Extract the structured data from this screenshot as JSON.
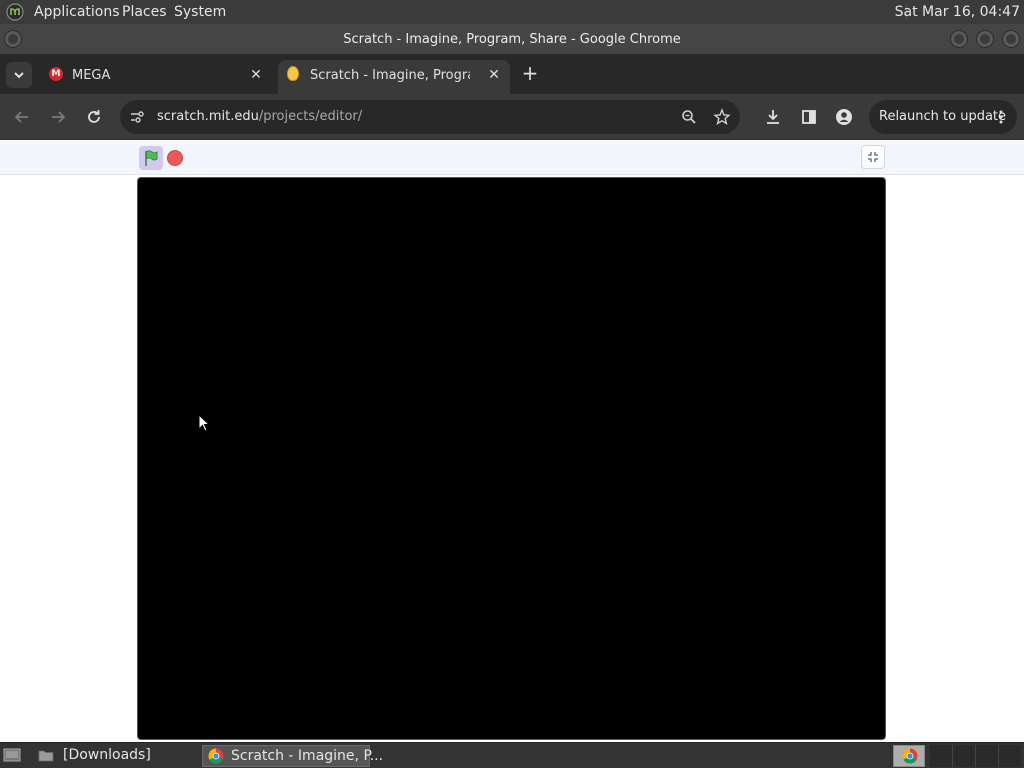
{
  "top_panel": {
    "menus": [
      "Applications",
      "Places",
      "System"
    ],
    "clock": "Sat Mar 16, 04:47"
  },
  "window": {
    "title": "Scratch - Imagine, Program, Share - Google Chrome"
  },
  "tabs": [
    {
      "label": "MEGA",
      "active": false,
      "icon": "mega-icon",
      "icon_color": "#d9272e"
    },
    {
      "label": "Scratch - Imagine, Program, Share",
      "active": true,
      "icon": "scratch-icon",
      "icon_color": "#f7c642"
    }
  ],
  "toolbar": {
    "url_host": "scratch.mit.edu",
    "url_path": "/projects/editor/",
    "relaunch_label": "Relaunch to update"
  },
  "stage": {
    "background": "#000000",
    "flag_color": "#4cbf56",
    "stop_color": "#ec5959"
  },
  "taskbar": {
    "items": [
      {
        "label": "[Downloads]",
        "icon": "folder-icon"
      },
      {
        "label": "Scratch - Imagine, P...",
        "icon": "chrome-icon",
        "active": true
      }
    ]
  }
}
